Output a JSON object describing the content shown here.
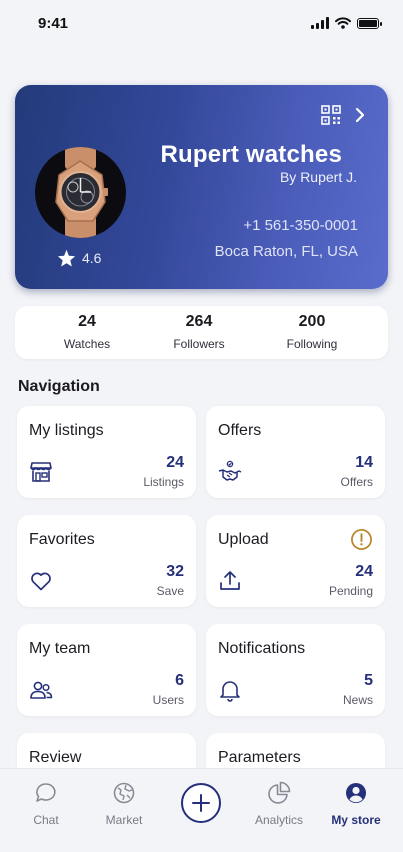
{
  "status_bar": {
    "time": "9:41"
  },
  "profile": {
    "store_name": "Rupert watches",
    "owner": "By Rupert J.",
    "phone": "+1 561-350-0001",
    "location": "Boca Raton, FL, USA",
    "rating": "4.6"
  },
  "stats": [
    {
      "value": "24",
      "label": "Watches"
    },
    {
      "value": "264",
      "label": "Followers"
    },
    {
      "value": "200",
      "label": "Following"
    }
  ],
  "navigation": {
    "title": "Navigation",
    "cards": [
      {
        "title": "My listings",
        "count": "24",
        "sub": "Listings",
        "icon": "store-icon"
      },
      {
        "title": "Offers",
        "count": "14",
        "sub": "Offers",
        "icon": "handshake-icon"
      },
      {
        "title": "Favorites",
        "count": "32",
        "sub": "Save",
        "icon": "heart-icon"
      },
      {
        "title": "Upload",
        "count": "24",
        "sub": "Pending",
        "icon": "upload-icon",
        "alert": "alert-circle-icon"
      },
      {
        "title": "My team",
        "count": "6",
        "sub": "Users",
        "icon": "users-icon"
      },
      {
        "title": "Notifications",
        "count": "5",
        "sub": "News",
        "icon": "bell-icon"
      },
      {
        "title": "Review"
      },
      {
        "title": "Parameters"
      }
    ]
  },
  "tab_bar": {
    "tabs": [
      {
        "label": "Chat",
        "icon": "chat-icon"
      },
      {
        "label": "Market",
        "icon": "globe-icon"
      },
      {
        "label": "",
        "icon": "plus-icon"
      },
      {
        "label": "Analytics",
        "icon": "pie-chart-icon"
      },
      {
        "label": "My store",
        "icon": "user-circle-icon"
      }
    ],
    "active": "My store"
  },
  "colors": {
    "accent": "#26307a",
    "card_gradient_start": "#233a7a",
    "card_gradient_end": "#5a6ccc",
    "alert": "#b8862a",
    "background": "#f3f4f8"
  }
}
